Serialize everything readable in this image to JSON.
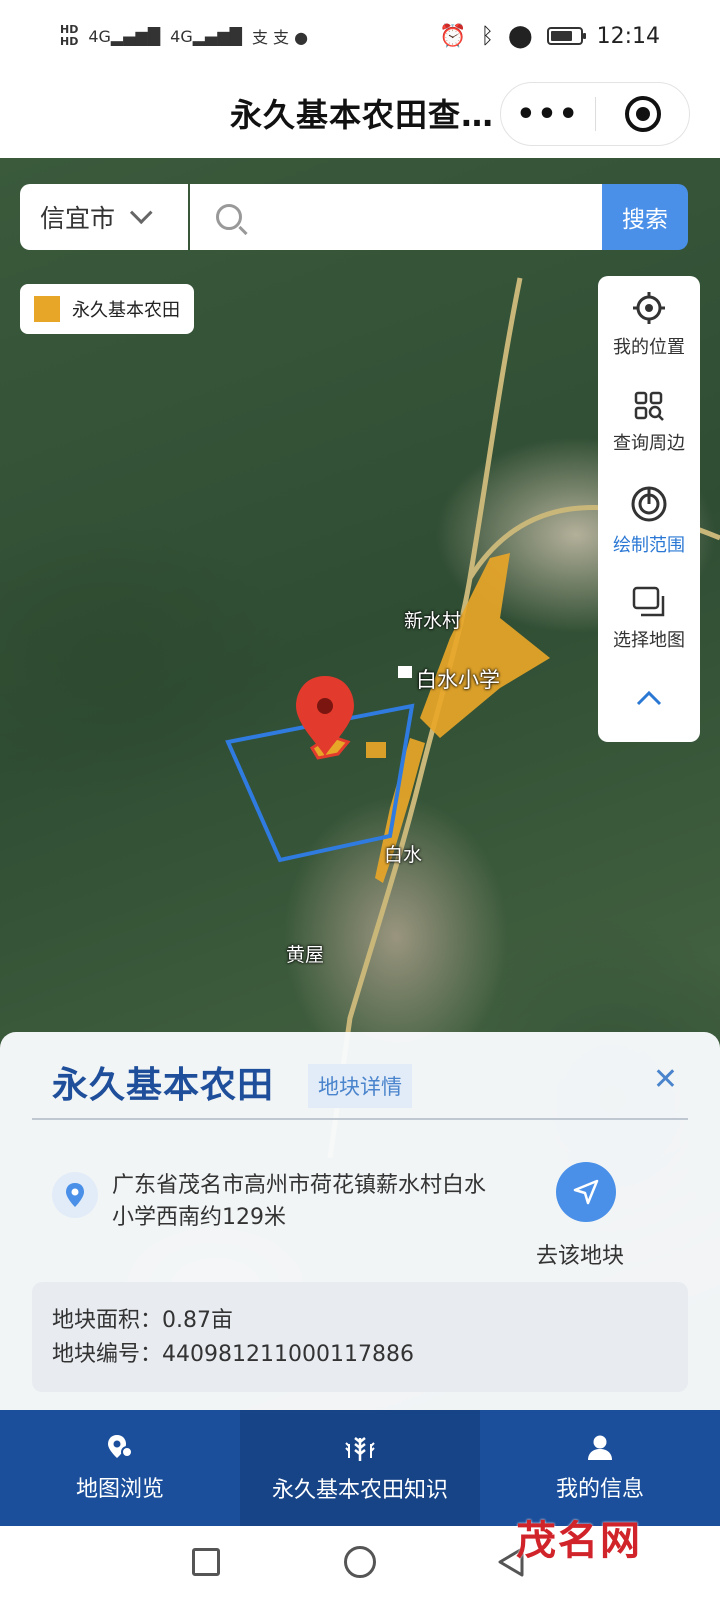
{
  "status": {
    "time": "12:14"
  },
  "window": {
    "title": "永久基本农田查…"
  },
  "map": {
    "city": "信宜市",
    "search_placeholder": "",
    "search_button": "搜索",
    "legend_label": "永久基本农田",
    "legend_color": "#e8a628",
    "tools": [
      {
        "label": "我的位置",
        "icon": "crosshair-icon"
      },
      {
        "label": "查询周边",
        "icon": "grid-search-icon"
      },
      {
        "label": "绘制范围",
        "icon": "draw-range-icon"
      },
      {
        "label": "选择地图",
        "icon": "layers-icon"
      }
    ],
    "places": [
      "新水村",
      "白水小学",
      "白水",
      "黄屋"
    ]
  },
  "card": {
    "title": "永久基本农田",
    "tag": "地块详情",
    "address": "广东省茂名市高州市荷花镇薪水村白水小学西南约129米",
    "go_label": "去该地块",
    "area": "地块面积：0.87亩",
    "code": "地块编号：440981211000117886"
  },
  "tabs": [
    {
      "label": "地图浏览",
      "icon": "map-pin-icon"
    },
    {
      "label": "永久基本农田知识",
      "icon": "wheat-icon"
    },
    {
      "label": "我的信息",
      "icon": "person-icon"
    }
  ],
  "watermark": "茂名网",
  "colors": {
    "primary": "#1b4f9b",
    "accent": "#4a90e8",
    "farmland": "#e8a628",
    "marker": "#e23a2c",
    "boundary": "#2f7be0"
  }
}
